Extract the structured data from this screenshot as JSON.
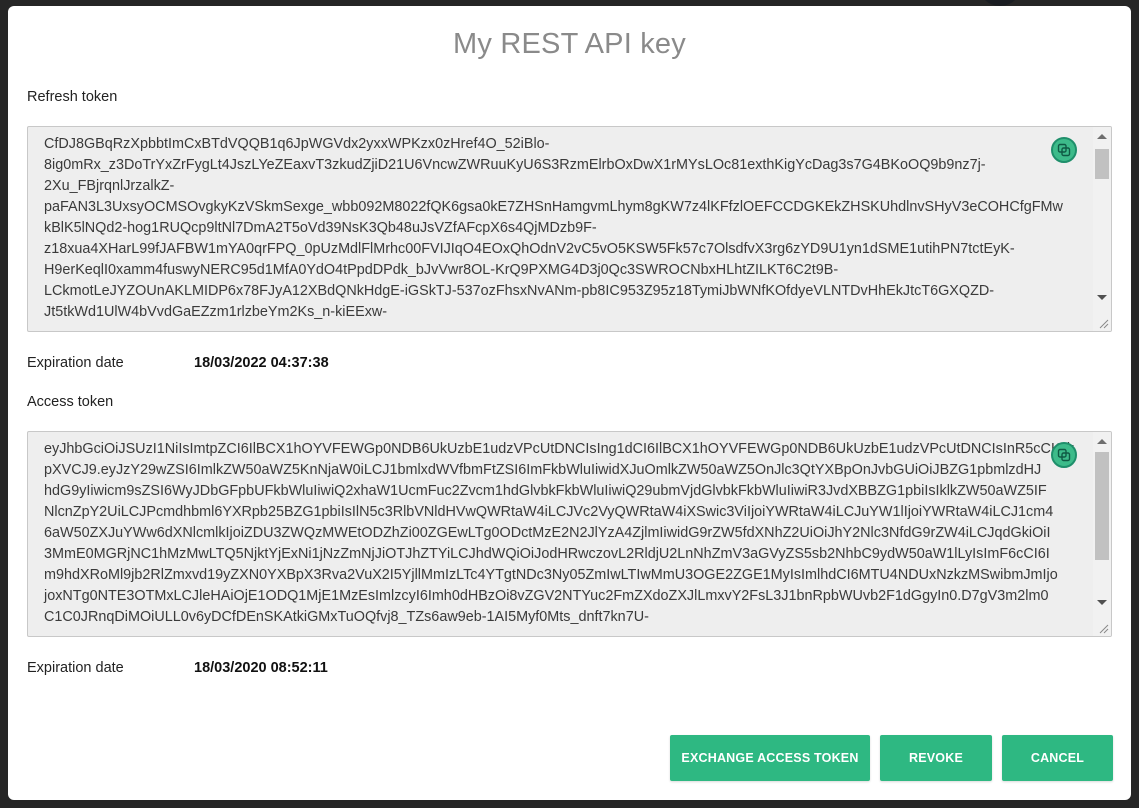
{
  "dialog": {
    "title": "My REST API key"
  },
  "refresh_token": {
    "label": "Refresh token",
    "lines": [
      "CfDJ8GBqRzXpbbtImCxBTdVQQB1q6JpWGVdx2yxxWPKzx0zHref4O_52iBlo-",
      "8ig0mRx_z3DoTrYxZrFygLt4JszLYeZEaxvT3zkudZjiD21U6VncwZWRuuKyU6S3RzmElrbOxDwX1rMYsLOc81exthKigYcDag3s7G4BKoOQ9b9nz7j-",
      "2Xu_FBjrqnlJrzalkZ-",
      "paFAN3L3UxsyOCMSOvgkyKzVSkmSexge_wbb092M8022fQK6gsa0kE7ZHSnHamgvmLhym8gKW7z4lKFfzlOEFCCDGKEkZHSKUhdlnvSHyV3eCOHCfgFMw",
      "kBlK5lNQd2-hog1RUQcp9ltNl7DmA2T5oVd39NsK3Qb48uJsVZfAFcpX6s4QjMDzb9F-",
      "z18xua4XHarL99fJAFBW1mYA0qrFPQ_0pUzMdlFlMrhc00FVIJIqO4EOxQhOdnV2vC5vO5KSW5Fk57c7OlsdfvX3rg6zYD9U1yn1dSME1utihPN7tctEyK-",
      "H9erKeqlI0xamm4fuswyNERC95d1MfA0YdO4tPpdDPdk_bJvVwr8OL-KrQ9PXMG4D3j0Qc3SWROCNbxHLhtZILKT6C2t9B-",
      "LCkmotLeJYZOUnAKLMIDP6x78FJyA12XBdQNkHdgE-iGSkTJ-537ozFhsxNvANm-pb8IC953Z95z18TymiJbWNfKOfdyeVLNTDvHhEkJtcT6GXQZD-",
      "Jt5tkWd1UlW4bVvdGaEZzm1rlzbeYm2Ks_n-kiEExw-"
    ],
    "expiration_label": "Expiration date",
    "expiration_value": "18/03/2022 04:37:38"
  },
  "access_token": {
    "label": "Access token",
    "lines": [
      "eyJhbGciOiJSUzI1NiIsImtpZCI6IlBCX1hOYVFEWGp0NDB6UkUzbE1udzVPcUtDNCIsIng1dCI6IlBCX1hOYVFEWGp0NDB6UkUzbE1udzVPcUtDNCIsInR5cCI6Ik",
      "pXVCJ9.eyJzY29wZSI6ImlkZW50aWZ5KnNjaW0iLCJ1bmlxdWVfbmFtZSI6ImFkbWluIiwidXJuOmlkZW50aWZ5OnJlc3QtYXBpOnJvbGUiOiJBZG1pbmlzdHJ",
      "hdG9yIiwicm9sZSI6WyJDbGFpbUFkbWluIiwiQ2xhaW1UcmFuc2Zvcm1hdGlvbkFkbWluIiwiQ29ubmVjdGlvbkFkbWluIiwiR3JvdXBBZG1pbiIsIklkZW50aWZ5IF",
      "NlcnZpY2UiLCJPcmdhbml6YXRpb25BZG1pbiIsIlN5c3RlbVNldHVwQWRtaW4iLCJVc2VyQWRtaW4iXSwic3ViIjoiYWRtaW4iLCJuYW1lIjoiYWRtaW4iLCJ1cm4",
      "6aW50ZXJuYWw6dXNlcmlkIjoiZDU3ZWQzMWEtODZhZi00ZGEwLTg0ODctMzE2N2JlYzA4ZjlmIiwidG9rZW5fdXNhZ2UiOiJhY2Nlc3NfdG9rZW4iLCJqdGkiOiI",
      "3MmE0MGRjNC1hMzMwLTQ5NjktYjExNi1jNzZmNjJiOTJhZTYiLCJhdWQiOiJodHRwczovL2RldjU2LnNhZmV3aGVyZS5sb2NhbC9ydW50aW1lLyIsImF6cCI6I",
      "m9hdXRoMl9jb2RlZmxvd19yZXN0YXBpX3Rva2VuX2I5YjllMmIzLTc4YTgtNDc3Ny05ZmIwLTIwMmU3OGE2ZGE1MyIsImlhdCI6MTU4NDUxNzkzMSwibmJmIjo",
      "joxNTg0NTE3OTMxLCJleHAiOjE1ODQ1MjE1MzEsImlzcyI6Imh0dHBzOi8vZGV2NTYuc2FmZXdoZXJlLmxvY2FsL3J1bnRpbWUvb2F1dGgyIn0.D7gV3m2lm0",
      "C1C0JRnqDiMOiULL0v6yDCfDEnSKAtkiGMxTuOQfvj8_TZs6aw9eb-1AI5Myf0Mts_dnft7kn7U-"
    ],
    "expiration_label": "Expiration date",
    "expiration_value": "18/03/2020 08:52:11"
  },
  "actions": {
    "exchange_label": "EXCHANGE ACCESS TOKEN",
    "revoke_label": "REVOKE",
    "cancel_label": "CANCEL"
  },
  "icons": {
    "copy": "copy-icon",
    "scroll_up": "scroll-up-arrow",
    "scroll_down": "scroll-down-arrow",
    "resize": "resize-grip"
  },
  "colors": {
    "accent": "#2eb882",
    "copy_button": "#3dbb8a",
    "title": "#8a8a8a"
  }
}
